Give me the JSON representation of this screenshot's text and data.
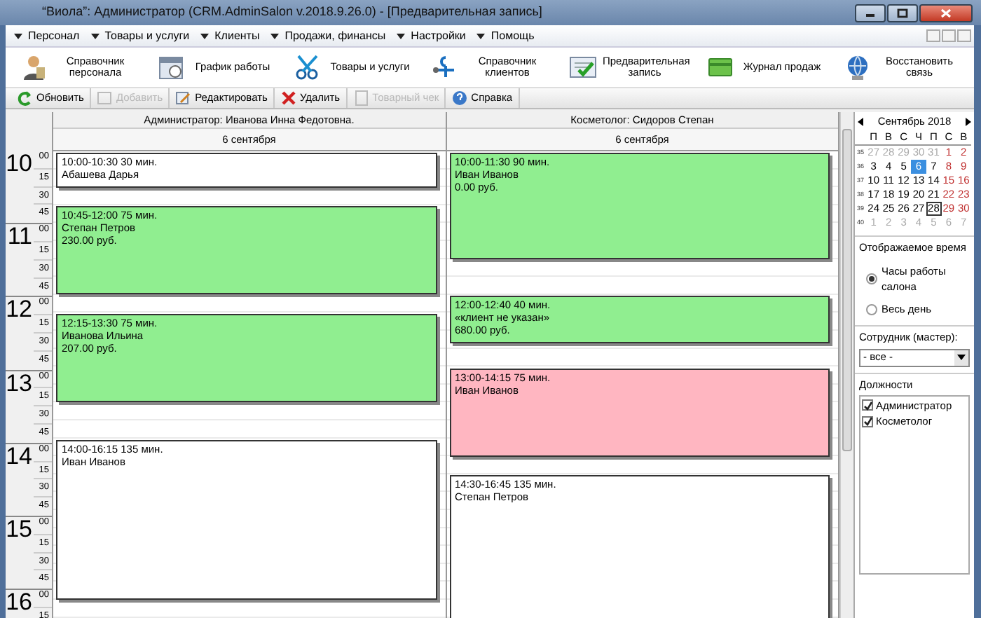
{
  "window": {
    "title": "“Виола”: Администратор (CRM.AdminSalon v.2018.9.26.0) - [Предварительная запись]"
  },
  "menu": [
    "Персонал",
    "Товары и услуги",
    "Клиенты",
    "Продажи, финансы",
    "Настройки",
    "Помощь"
  ],
  "toolbar": [
    {
      "kind": "staff",
      "label": "Справочник персонала"
    },
    {
      "kind": "schedule",
      "label": "График работы"
    },
    {
      "kind": "goods",
      "label": "Товары и услуги"
    },
    {
      "kind": "clients",
      "label": "Справочник клиентов"
    },
    {
      "kind": "booking",
      "label": "Предварительная запись"
    },
    {
      "kind": "sales",
      "label": "Журнал продаж"
    },
    {
      "kind": "reconnect",
      "label": "Восстановить связь"
    }
  ],
  "actions": [
    {
      "kind": "refresh",
      "label": "Обновить",
      "disabled": false
    },
    {
      "kind": "add",
      "label": "Добавить",
      "disabled": true
    },
    {
      "kind": "edit",
      "label": "Редактировать",
      "disabled": false
    },
    {
      "kind": "delete",
      "label": "Удалить",
      "disabled": false
    },
    {
      "kind": "receipt",
      "label": "Товарный чек",
      "disabled": true
    },
    {
      "kind": "help",
      "label": "Справка",
      "disabled": false
    }
  ],
  "time_scale": [
    {
      "hour": "10",
      "minutes": [
        "00",
        "15",
        "30",
        "45"
      ]
    },
    {
      "hour": "11",
      "minutes": [
        "00",
        "15",
        "30",
        "45"
      ]
    },
    {
      "hour": "12",
      "minutes": [
        "00",
        "15",
        "30",
        "45"
      ]
    },
    {
      "hour": "13",
      "minutes": [
        "00",
        "15",
        "30",
        "45"
      ]
    },
    {
      "hour": "14",
      "minutes": [
        "00",
        "15",
        "30",
        "45"
      ]
    },
    {
      "hour": "15",
      "minutes": [
        "00",
        "15",
        "30",
        "45"
      ]
    },
    {
      "hour": "16",
      "minutes": [
        "00",
        "15"
      ]
    }
  ],
  "columns": [
    {
      "employee": "Администратор: Иванова Инна Федотовна.",
      "date": "6 сентября",
      "appointments": [
        {
          "header": "10:00-10:30 30 мин.",
          "client": "Абашева Дарья",
          "color": "#ffffff"
        },
        {
          "header": "10:45-12:00 75 мин.",
          "client": "Степан Петров",
          "price": "230.00 руб.",
          "color": "#90ee90"
        },
        {
          "header": "12:15-13:30 75 мин.",
          "client": "Иванова Ильина",
          "price": "207.00 руб.",
          "color": "#90ee90"
        },
        {
          "header": "14:00-16:15 135 мин.",
          "client": "Иван Иванов",
          "color": "#ffffff"
        }
      ]
    },
    {
      "employee": "Косметолог: Сидоров Степан",
      "date": "6 сентября",
      "appointments": [
        {
          "header": "10:00-11:30 90 мин.",
          "client": "Иван Иванов",
          "price": "0.00 руб.",
          "color": "#90ee90"
        },
        {
          "header": "12:00-12:40 40 мин.",
          "client": "«клиент не указан»",
          "price": "680.00 руб.",
          "color": "#90ee90"
        },
        {
          "header": "13:00-14:15 75 мин.",
          "client": "Иван Иванов",
          "color": "#ffb6c1"
        },
        {
          "header": "14:30-16:45 135 мин.",
          "client": "Степан Петров",
          "color": "#ffffff"
        }
      ]
    }
  ],
  "calendar": {
    "month": "Сентябрь 2018",
    "weekdays": [
      "П",
      "В",
      "С",
      "Ч",
      "П",
      "С",
      "В"
    ],
    "weeks": [
      {
        "number": "35",
        "days": [
          {
            "d": "27",
            "muted": true,
            "selected": false,
            "today": false
          },
          {
            "d": "28",
            "muted": true,
            "selected": false,
            "today": false
          },
          {
            "d": "29",
            "muted": true,
            "selected": false,
            "today": false
          },
          {
            "d": "30",
            "muted": true,
            "selected": false,
            "today": false
          },
          {
            "d": "31",
            "muted": true,
            "selected": false,
            "today": false
          },
          {
            "d": "1",
            "muted": false,
            "selected": false,
            "today": false
          },
          {
            "d": "2",
            "muted": false,
            "selected": false,
            "today": false
          }
        ]
      },
      {
        "number": "36",
        "days": [
          {
            "d": "3",
            "muted": false,
            "selected": false,
            "today": false
          },
          {
            "d": "4",
            "muted": false,
            "selected": false,
            "today": false
          },
          {
            "d": "5",
            "muted": false,
            "selected": false,
            "today": false
          },
          {
            "d": "6",
            "muted": false,
            "selected": true,
            "today": false
          },
          {
            "d": "7",
            "muted": false,
            "selected": false,
            "today": false
          },
          {
            "d": "8",
            "muted": false,
            "selected": false,
            "today": false
          },
          {
            "d": "9",
            "muted": false,
            "selected": false,
            "today": false
          }
        ]
      },
      {
        "number": "37",
        "days": [
          {
            "d": "10",
            "muted": false,
            "selected": false,
            "today": false
          },
          {
            "d": "11",
            "muted": false,
            "selected": false,
            "today": false
          },
          {
            "d": "12",
            "muted": false,
            "selected": false,
            "today": false
          },
          {
            "d": "13",
            "muted": false,
            "selected": false,
            "today": false
          },
          {
            "d": "14",
            "muted": false,
            "selected": false,
            "today": false
          },
          {
            "d": "15",
            "muted": false,
            "selected": false,
            "today": false
          },
          {
            "d": "16",
            "muted": false,
            "selected": false,
            "today": false
          }
        ]
      },
      {
        "number": "38",
        "days": [
          {
            "d": "17",
            "muted": false,
            "selected": false,
            "today": false
          },
          {
            "d": "18",
            "muted": false,
            "selected": false,
            "today": false
          },
          {
            "d": "19",
            "muted": false,
            "selected": false,
            "today": false
          },
          {
            "d": "20",
            "muted": false,
            "selected": false,
            "today": false
          },
          {
            "d": "21",
            "muted": false,
            "selected": false,
            "today": false
          },
          {
            "d": "22",
            "muted": false,
            "selected": false,
            "today": false
          },
          {
            "d": "23",
            "muted": false,
            "selected": false,
            "today": false
          }
        ]
      },
      {
        "number": "39",
        "days": [
          {
            "d": "24",
            "muted": false,
            "selected": false,
            "today": false
          },
          {
            "d": "25",
            "muted": false,
            "selected": false,
            "today": false
          },
          {
            "d": "26",
            "muted": false,
            "selected": false,
            "today": false
          },
          {
            "d": "27",
            "muted": false,
            "selected": false,
            "today": false
          },
          {
            "d": "28",
            "muted": false,
            "selected": false,
            "today": true
          },
          {
            "d": "29",
            "muted": false,
            "selected": false,
            "today": false
          },
          {
            "d": "30",
            "muted": false,
            "selected": false,
            "today": false
          }
        ]
      },
      {
        "number": "40",
        "days": [
          {
            "d": "1",
            "muted": true,
            "selected": false,
            "today": false
          },
          {
            "d": "2",
            "muted": true,
            "selected": false,
            "today": false
          },
          {
            "d": "3",
            "muted": true,
            "selected": false,
            "today": false
          },
          {
            "d": "4",
            "muted": true,
            "selected": false,
            "today": false
          },
          {
            "d": "5",
            "muted": true,
            "selected": false,
            "today": false
          },
          {
            "d": "6",
            "muted": true,
            "selected": false,
            "today": false
          },
          {
            "d": "7",
            "muted": true,
            "selected": false,
            "today": false
          }
        ]
      }
    ]
  },
  "display_time": {
    "title": "Отображаемое время",
    "options": [
      {
        "label": "Часы работы салона",
        "selected": true
      },
      {
        "label": "Весь день",
        "selected": false
      }
    ]
  },
  "employee_filter": {
    "label": "Сотрудник (мастер):",
    "value": "- все -"
  },
  "positions": {
    "title": "Должности",
    "items": [
      {
        "label": "Администратор",
        "checked": true
      },
      {
        "label": "Косметолог",
        "checked": true
      }
    ]
  }
}
